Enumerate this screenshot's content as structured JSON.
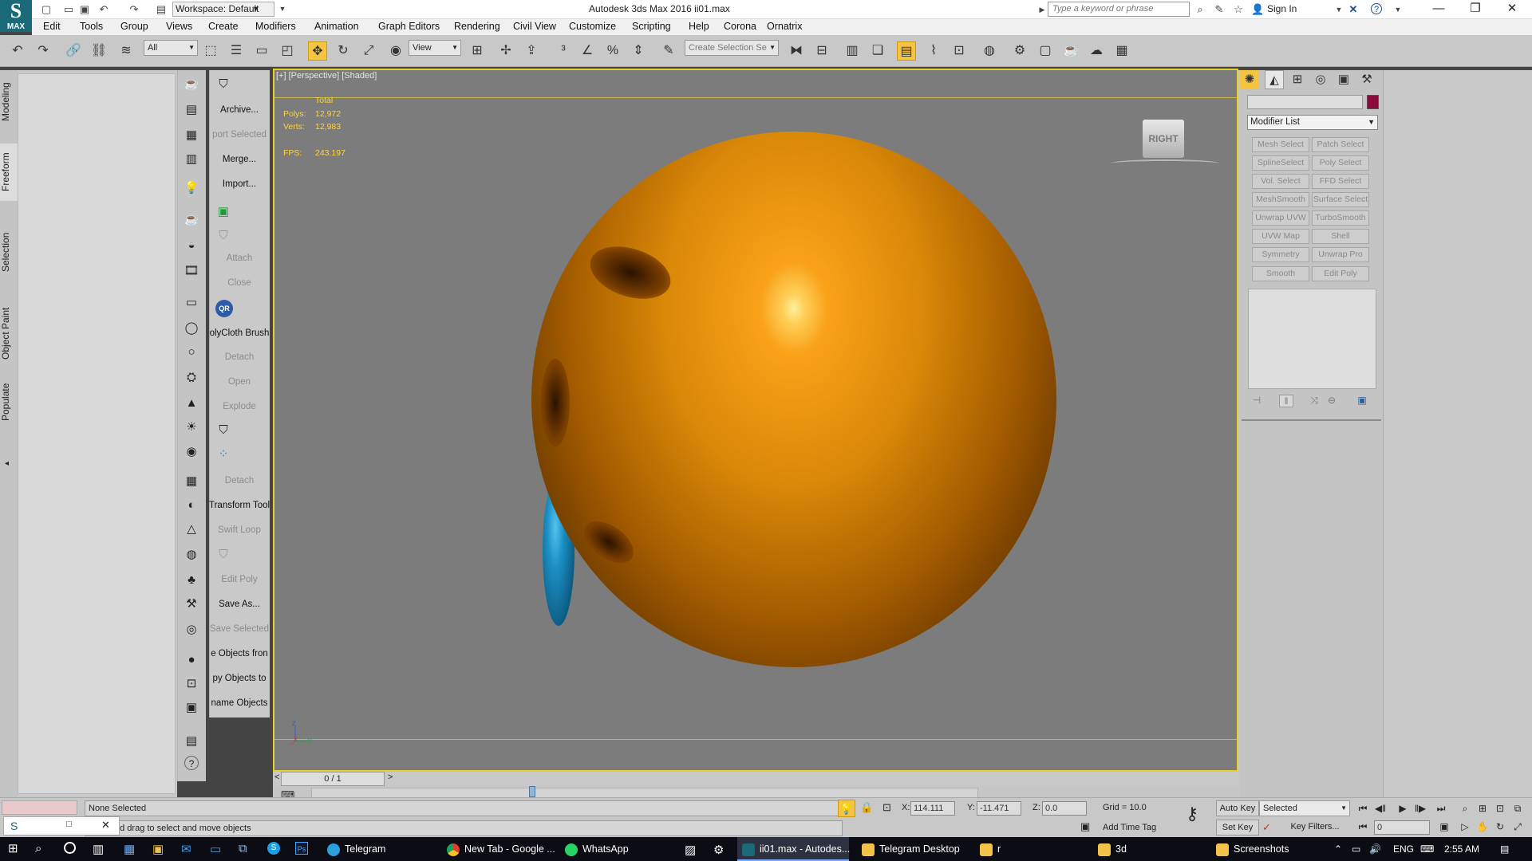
{
  "titlebar": {
    "workspace": "Workspace: Default",
    "app_title": "Autodesk 3ds Max 2016     ii01.max",
    "search_placeholder": "Type a keyword or phrase",
    "sign_in": "Sign In"
  },
  "logo": "MAX",
  "menu": [
    "Edit",
    "Tools",
    "Group",
    "Views",
    "Create",
    "Modifiers",
    "Animation",
    "Graph Editors",
    "Rendering",
    "Civil View",
    "Customize",
    "Scripting",
    "Help",
    "Corona",
    "Ornatrix"
  ],
  "toolbar": {
    "selection_filter": "All",
    "ref_coord": "View",
    "selection_set_placeholder": "Create Selection Se"
  },
  "left_tabs": [
    "Modeling",
    "Freeform",
    "Selection",
    "Object Paint",
    "Populate"
  ],
  "tool_column_text": [
    {
      "label": "Archive...",
      "state": "on"
    },
    {
      "label": "port Selected",
      "state": "dim"
    },
    {
      "label": "Merge...",
      "state": "on"
    },
    {
      "label": "Import...",
      "state": "on"
    },
    {
      "label": "",
      "state": "on"
    },
    {
      "label": "",
      "state": "on"
    },
    {
      "label": "Attach",
      "state": "dim"
    },
    {
      "label": "Close",
      "state": "dim"
    },
    {
      "label": "",
      "state": "on"
    },
    {
      "label": "olyCloth Brush",
      "state": "on"
    },
    {
      "label": "Detach",
      "state": "dim"
    },
    {
      "label": "Open",
      "state": "dim"
    },
    {
      "label": "Explode",
      "state": "dim"
    },
    {
      "label": "",
      "state": "on"
    },
    {
      "label": "",
      "state": "on"
    },
    {
      "label": "Detach",
      "state": "dim"
    },
    {
      "label": "Transform Tool",
      "state": "on"
    },
    {
      "label": "Swift Loop",
      "state": "dim"
    },
    {
      "label": "",
      "state": "on"
    },
    {
      "label": "Edit Poly",
      "state": "dim"
    },
    {
      "label": "Save As...",
      "state": "on"
    },
    {
      "label": "Save Selected",
      "state": "dim"
    },
    {
      "label": "e Objects fron",
      "state": "on"
    },
    {
      "label": "py Objects to",
      "state": "on"
    },
    {
      "label": "name Objects",
      "state": "on"
    }
  ],
  "viewport": {
    "label": "[+] [Perspective] [Shaded]",
    "stats_header": "Total",
    "polys_label": "Polys:",
    "polys_value": "12,972",
    "verts_label": "Verts:",
    "verts_value": "12,983",
    "fps_label": "FPS:",
    "fps_value": "243.197",
    "viewcube_label": "RIGHT",
    "axis_z": "z",
    "axis_x": "x",
    "axis_y": "y"
  },
  "timeslider": "0 / 1",
  "command_panel": {
    "modifier_list": "Modifier List",
    "buttons": [
      [
        "Mesh Select",
        "Patch Select"
      ],
      [
        "SplineSelect",
        "Poly Select"
      ],
      [
        "Vol. Select",
        "FFD Select"
      ],
      [
        "MeshSmooth",
        "Surface Select"
      ],
      [
        "Unwrap UVW",
        "TurboSmooth"
      ],
      [
        "UVW Map",
        "Shell"
      ],
      [
        "Symmetry",
        "Unwrap Pro"
      ],
      [
        "Smooth",
        "Edit Poly"
      ]
    ]
  },
  "status": {
    "selection": "None Selected",
    "prompt": "Click and drag to select and move objects",
    "x_label": "X:",
    "x_value": "114.111",
    "y_label": "Y:",
    "y_value": "-11.471",
    "z_label": "Z:",
    "z_value": "0.0",
    "grid": "Grid = 10.0",
    "add_time_tag": "Add Time Tag",
    "auto_key": "Auto Key",
    "set_key": "Set Key",
    "key_mode": "Selected",
    "key_filters": "Key Filters...",
    "frame": "0"
  },
  "taskbar": {
    "items": [
      "Telegram",
      "New Tab - Google ...",
      "WhatsApp",
      "ii01.max - Autodes...",
      "Telegram Desktop",
      "r",
      "3d",
      "Screenshots"
    ],
    "lang": "ENG",
    "time": "2:55 AM"
  },
  "colors": {
    "viewport_border": "#e8d02c",
    "sphere": "#d98807",
    "lobe": "#1b8fc4",
    "stats": "#ffd33d"
  }
}
